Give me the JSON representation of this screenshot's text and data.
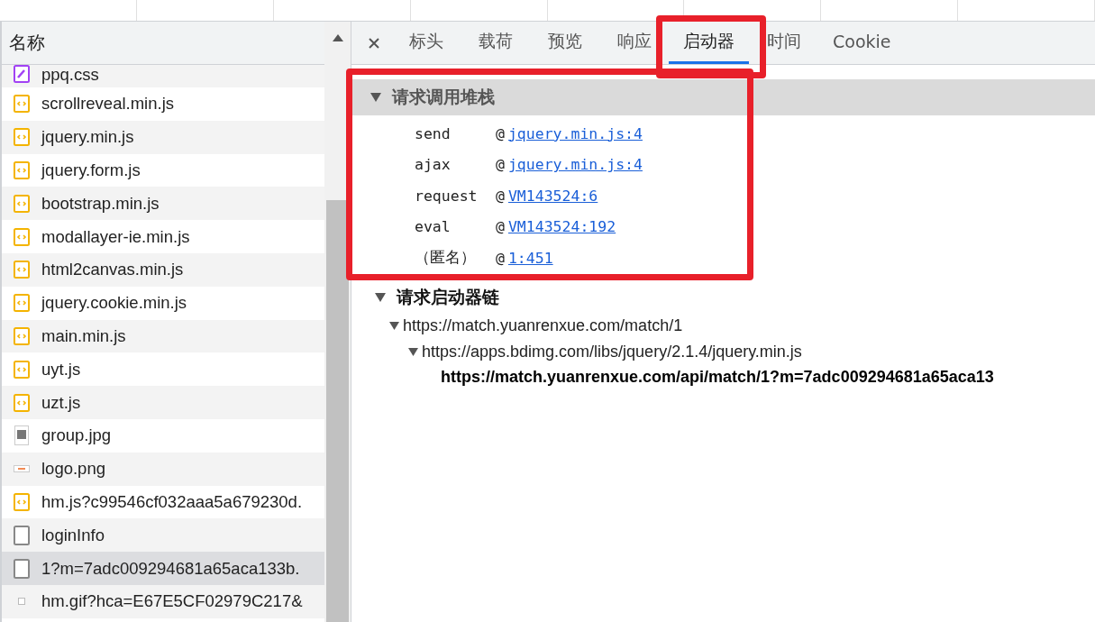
{
  "request_list": {
    "header": "名称",
    "items": [
      {
        "name": "ppq.css",
        "kind": "stylesheet",
        "selected": false
      },
      {
        "name": "scrollreveal.min.js",
        "kind": "script",
        "selected": false
      },
      {
        "name": "jquery.min.js",
        "kind": "script",
        "selected": false
      },
      {
        "name": "jquery.form.js",
        "kind": "script",
        "selected": false
      },
      {
        "name": "bootstrap.min.js",
        "kind": "script",
        "selected": false
      },
      {
        "name": "modallayer-ie.min.js",
        "kind": "script",
        "selected": false
      },
      {
        "name": "html2canvas.min.js",
        "kind": "script",
        "selected": false
      },
      {
        "name": "jquery.cookie.min.js",
        "kind": "script",
        "selected": false
      },
      {
        "name": "main.min.js",
        "kind": "script",
        "selected": false
      },
      {
        "name": "uyt.js",
        "kind": "script",
        "selected": false
      },
      {
        "name": "uzt.js",
        "kind": "script",
        "selected": false
      },
      {
        "name": "group.jpg",
        "kind": "photo",
        "selected": false
      },
      {
        "name": "logo.png",
        "kind": "image",
        "selected": false
      },
      {
        "name": "hm.js?c99546cf032aaa5a679230d.",
        "kind": "script",
        "selected": false
      },
      {
        "name": "loginInfo",
        "kind": "document",
        "selected": false
      },
      {
        "name": "1?m=7adc009294681a65aca133b.",
        "kind": "document",
        "selected": true
      },
      {
        "name": "hm.gif?hca=E67E5CF02979C217&",
        "kind": "pixel",
        "selected": false
      }
    ]
  },
  "detail_tabs": [
    {
      "label": "标头",
      "selected": false
    },
    {
      "label": "载荷",
      "selected": false
    },
    {
      "label": "预览",
      "selected": false
    },
    {
      "label": "响应",
      "selected": false
    },
    {
      "label": "启动器",
      "selected": true
    },
    {
      "label": "时间",
      "selected": false
    },
    {
      "label": "Cookie",
      "selected": false
    }
  ],
  "call_stack": {
    "title": "请求调用堆栈",
    "expanded": true,
    "frames": [
      {
        "function": "send",
        "at": "@",
        "location": "jquery.min.js:4"
      },
      {
        "function": "ajax",
        "at": "@",
        "location": "jquery.min.js:4"
      },
      {
        "function": "request",
        "at": "@",
        "location": "VM143524:6"
      },
      {
        "function": "eval",
        "at": "@",
        "location": "VM143524:192"
      },
      {
        "function": "（匿名）",
        "at": "@",
        "location": "1:451"
      }
    ]
  },
  "initiator_chain": {
    "title": "请求启动器链",
    "expanded": true,
    "tree": [
      {
        "url": "https://match.yuanrenxue.com/match/1",
        "current": false,
        "expanded": true,
        "children": [
          {
            "url": "https://apps.bdimg.com/libs/jquery/2.1.4/jquery.min.js",
            "current": false,
            "expanded": true,
            "children": [
              {
                "url": "https://match.yuanrenxue.com/api/match/1?m=7adc009294681a65aca13",
                "current": true
              }
            ]
          }
        ]
      }
    ]
  }
}
